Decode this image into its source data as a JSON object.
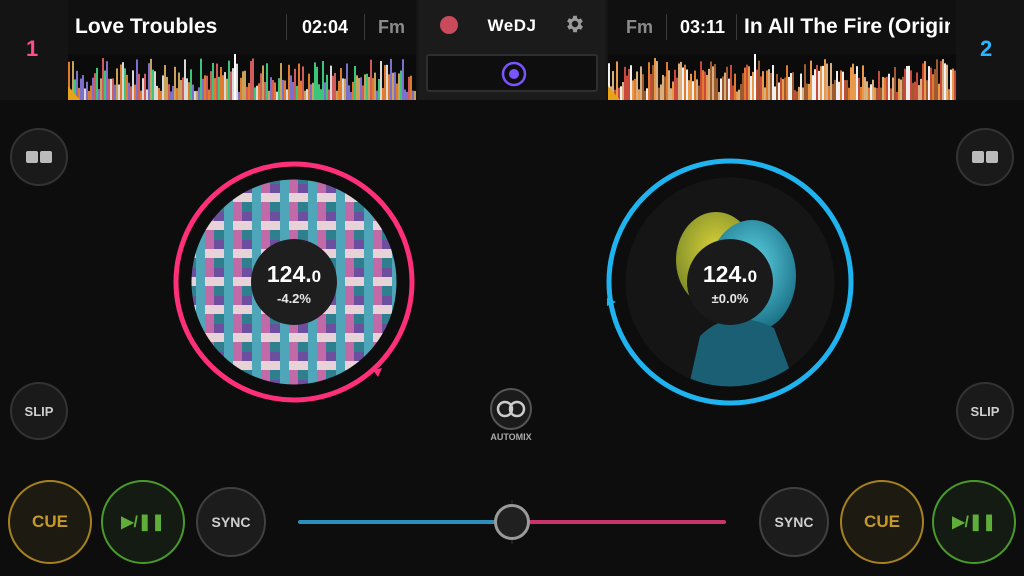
{
  "app": {
    "name": "WeDJ"
  },
  "colors": {
    "deck_a": "#ff4d8a",
    "deck_b": "#29b6ff",
    "cue": "#c69b2c",
    "play": "#5fae3a",
    "record": "#c94a5a",
    "accent": "#7a55ff"
  },
  "deck_a": {
    "number": "1",
    "title": "Love Troubles",
    "time": "02:04",
    "key": "Fm",
    "bpm_int": "124.",
    "bpm_dec": "0",
    "pitch": "-4.2%"
  },
  "deck_b": {
    "number": "2",
    "title": "In All The Fire (Origin",
    "time": "03:11",
    "key": "Fm",
    "bpm_int": "124.",
    "bpm_dec": "0",
    "pitch": "±0.0%"
  },
  "controls": {
    "slip_label": "SLIP",
    "cue_label": "CUE",
    "play_label": "▶/❚❚",
    "sync_label": "SYNC",
    "automix_label": "AUTOMIX"
  },
  "icons": {
    "record": "record-icon",
    "settings": "gear-icon",
    "center_button": "target-icon",
    "split_view": "split-view-icon",
    "automix": "automix-icon"
  }
}
